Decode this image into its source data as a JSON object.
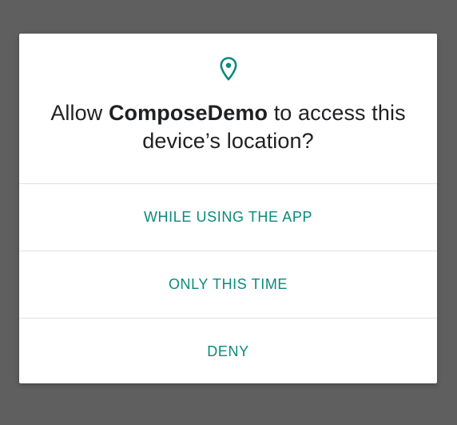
{
  "dialog": {
    "icon": "location-pin-icon",
    "prompt_prefix": "Allow ",
    "app_name": "ComposeDemo",
    "prompt_suffix": " to access this device’s location?",
    "options": [
      {
        "label": "WHILE USING THE APP"
      },
      {
        "label": "ONLY THIS TIME"
      },
      {
        "label": "DENY"
      }
    ]
  },
  "colors": {
    "accent": "#0b8a7c",
    "scrim": "#5f5f5f",
    "dialog_background": "#ffffff",
    "text": "#202124",
    "divider": "#e2e2e2"
  }
}
